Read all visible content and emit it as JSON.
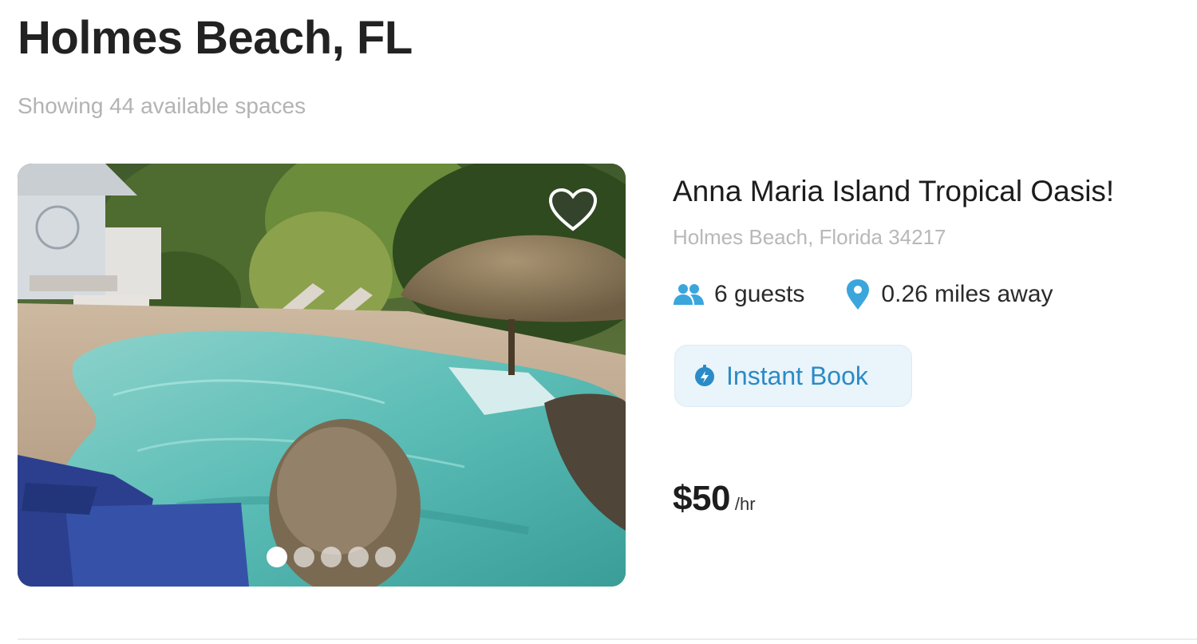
{
  "page": {
    "title": "Holmes Beach, FL",
    "results_text": "Showing 44 available spaces"
  },
  "listing": {
    "title": "Anna Maria Island Tropical Oasis!",
    "location": "Holmes Beach, Florida 34217",
    "guests": "6 guests",
    "distance": "0.26 miles away",
    "instant_book_label": "Instant Book",
    "price_amount": "$50",
    "price_unit": "/hr",
    "photo": {
      "total_photos": 5,
      "current_photo": 1
    }
  },
  "icons": {
    "favorite": "heart-icon",
    "guests": "people-icon",
    "distance": "map-pin-icon",
    "instant_book": "lightning-bolt-icon"
  },
  "colors": {
    "accent": "#2a8bc7",
    "instant_book_bg": "#eaf4fb",
    "icon_blue": "#3aa6dc",
    "muted_text": "#b3b3b3"
  }
}
